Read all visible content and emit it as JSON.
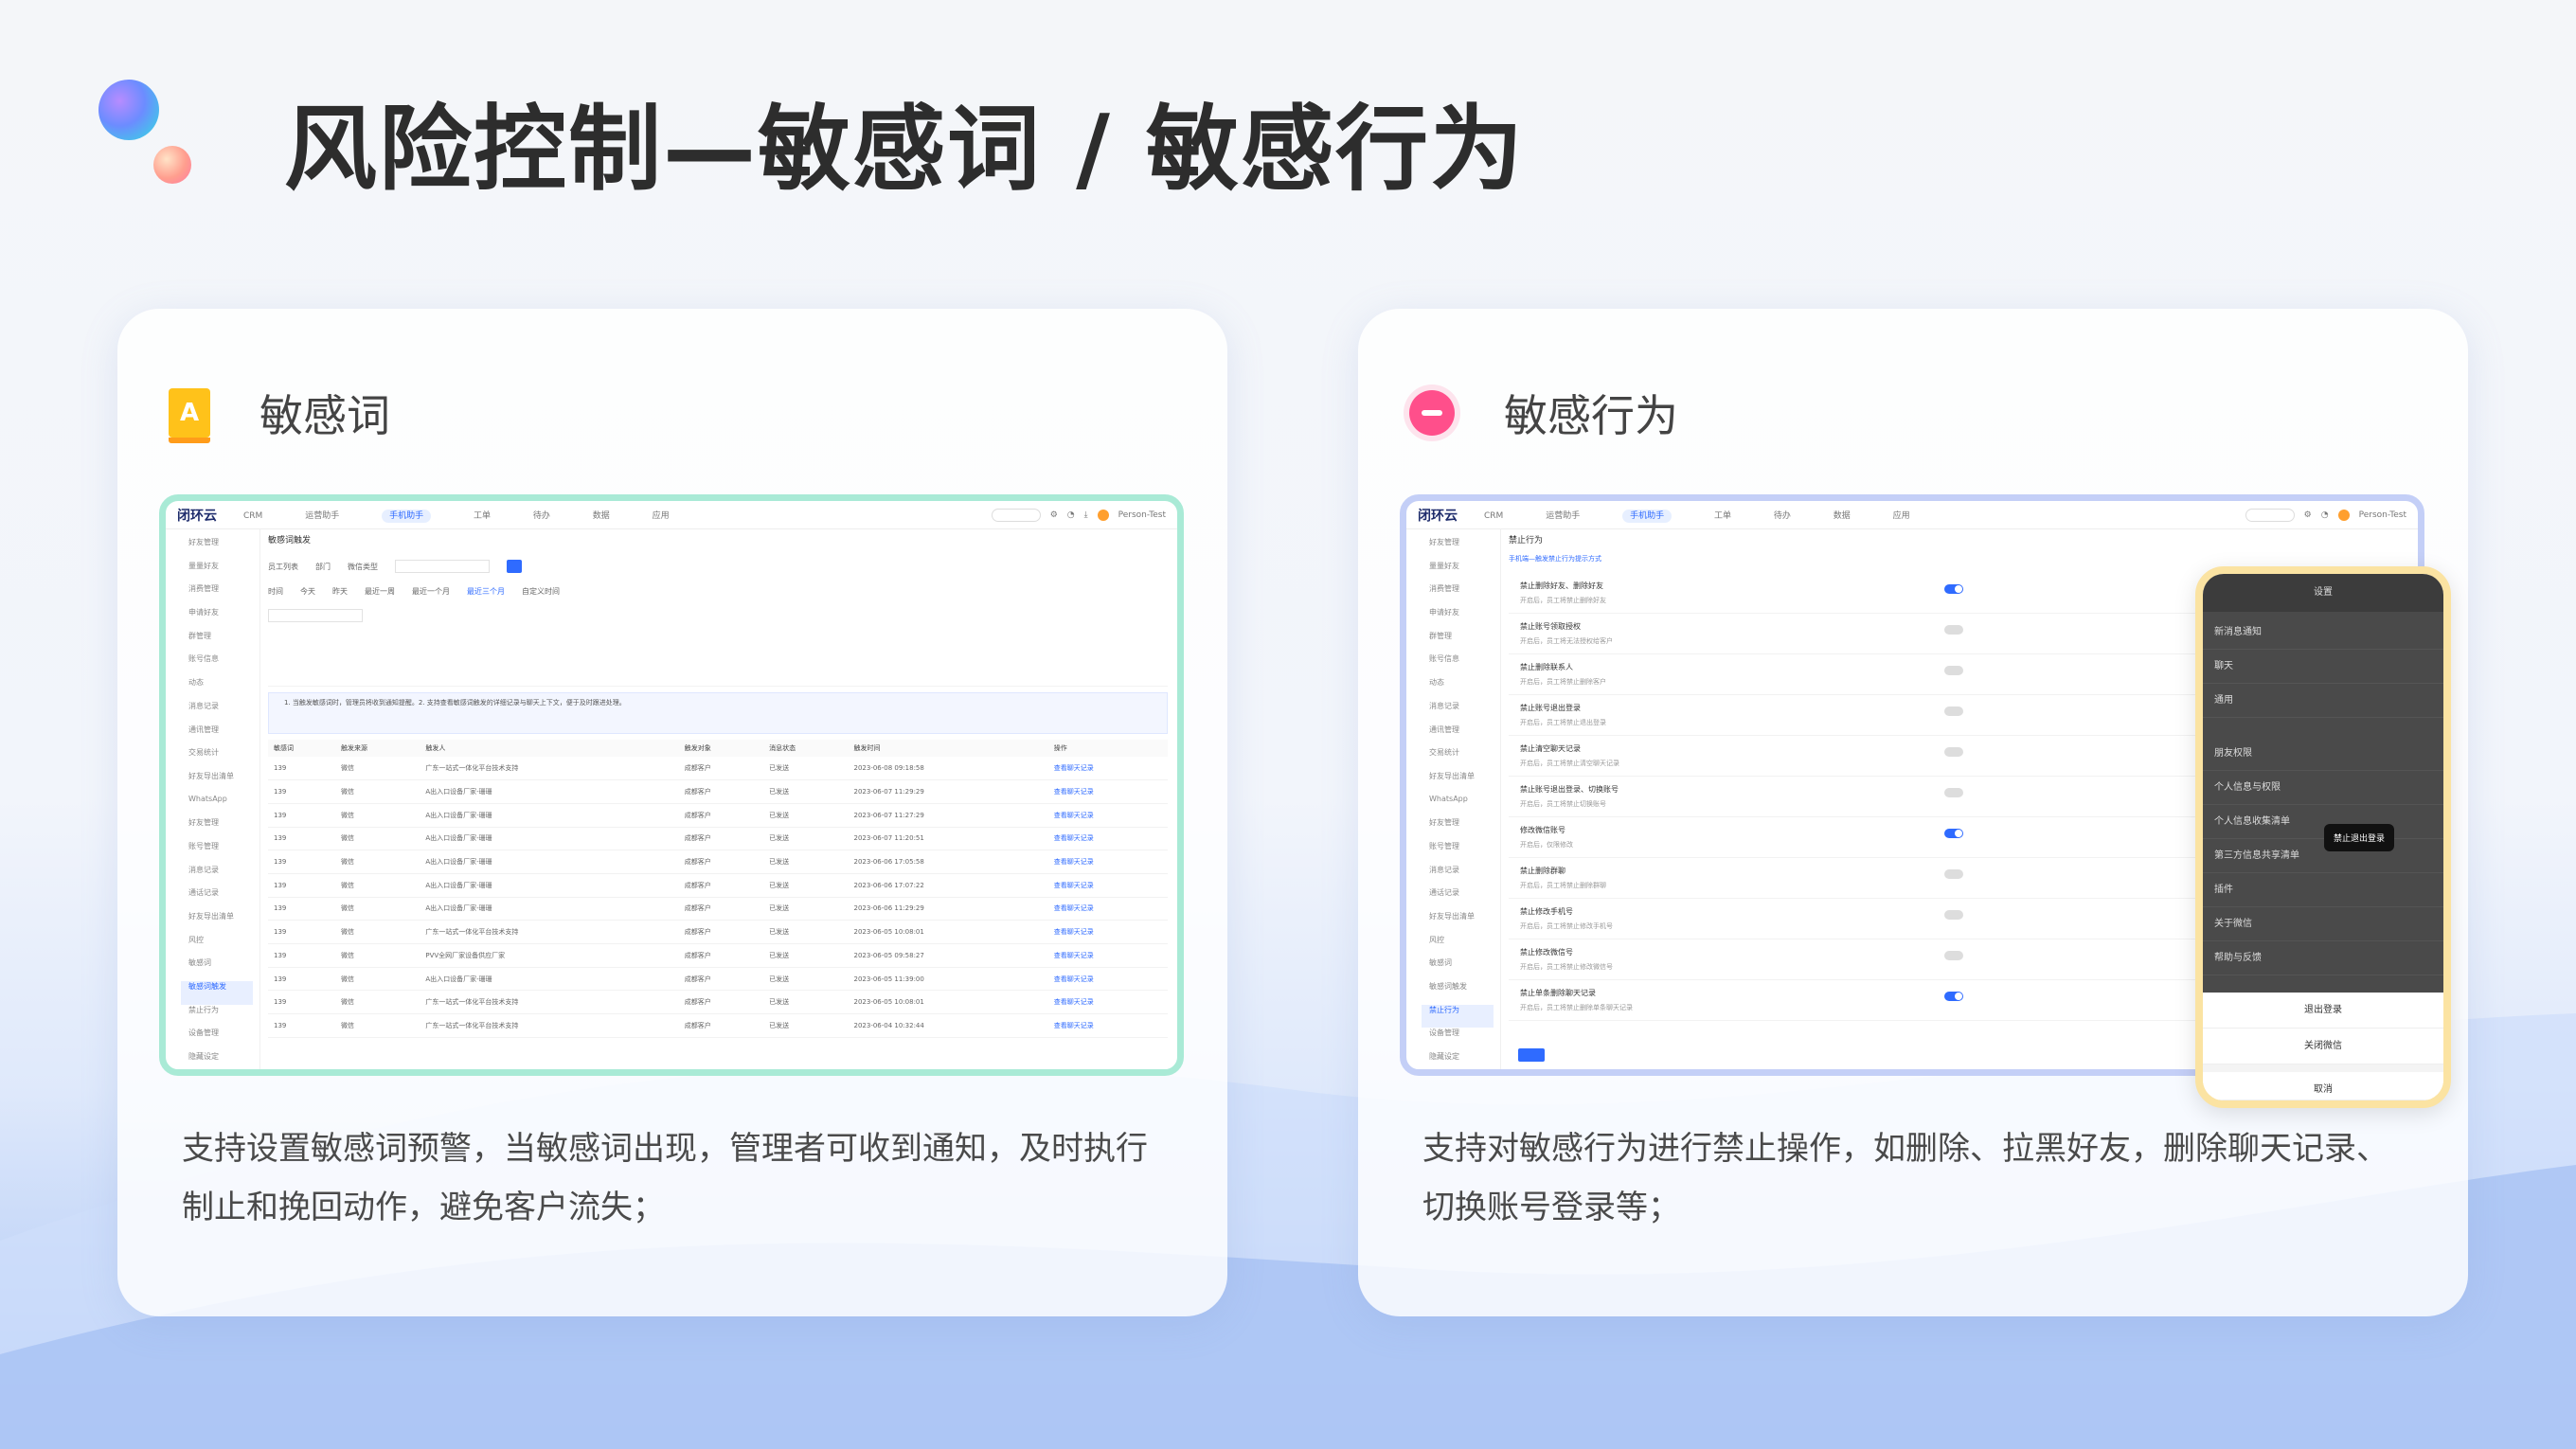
{
  "page": {
    "title": "风险控制—敏感词 / 敏感行为"
  },
  "cards": [
    {
      "heading": "敏感词",
      "icon": "sensitive-word-icon",
      "description": "支持设置敏感词预警，当敏感词出现，管理者可收到通知，及时执行制止和挽回动作，避免客户流失；"
    },
    {
      "heading": "敏感行为",
      "icon": "forbidden-icon",
      "description": "支持对敏感行为进行禁止操作，如删除、拉黑好友，删除聊天记录、切换账号登录等；"
    }
  ],
  "app": {
    "logo": "闭环云",
    "nav": [
      "CRM",
      "运营助手",
      "手机助手",
      "工单",
      "待办",
      "数据",
      "应用"
    ],
    "active_nav": "手机助手",
    "user": "Person-Test"
  },
  "word_screen": {
    "breadcrumb": "敏感词触发",
    "sidebar": [
      "好友管理",
      "量量好友",
      "消费管理",
      "申请好友",
      "群管理",
      "账号信息",
      "动态",
      "消息记录",
      "通讯管理",
      "交易统计",
      "好友导出清单",
      "WhatsApp",
      "好友管理",
      "账号管理",
      "消息记录",
      "通话记录",
      "好友导出清单",
      "风控",
      "敏感词",
      "敏感词触发",
      "禁止行为",
      "设备管理",
      "隐藏设定"
    ],
    "sidebar_active": "敏感词触发",
    "filters": [
      "员工列表",
      "部门",
      "微信类型",
      "时间"
    ],
    "time_options": [
      "今天",
      "昨天",
      "最近一周",
      "最近一个月",
      "最近三个月",
      "自定义时间"
    ],
    "notice": "1. 当触发敏感词时，管理员将收到通知提醒。2. 支持查看敏感词触发的详细记录与聊天上下文，便于及时跟进处理。",
    "table": {
      "headers": [
        "敏感词",
        "触发来源",
        "触发人",
        "触发对象",
        "消息状态",
        "触发时间",
        "操作"
      ],
      "rows": [
        [
          "139",
          "微信",
          "广东一站式一体化平台技术支持",
          "成都客户",
          "已发送",
          "2023-06-08 09:18:58",
          "查看聊天记录"
        ],
        [
          "139",
          "微信",
          "A出入口设备厂家-珊珊",
          "成都客户",
          "已发送",
          "2023-06-07 11:29:29",
          "查看聊天记录"
        ],
        [
          "139",
          "微信",
          "A出入口设备厂家-珊珊",
          "成都客户",
          "已发送",
          "2023-06-07 11:27:29",
          "查看聊天记录"
        ],
        [
          "139",
          "微信",
          "A出入口设备厂家-珊珊",
          "成都客户",
          "已发送",
          "2023-06-07 11:20:51",
          "查看聊天记录"
        ],
        [
          "139",
          "微信",
          "A出入口设备厂家-珊珊",
          "成都客户",
          "已发送",
          "2023-06-06 17:05:58",
          "查看聊天记录"
        ],
        [
          "139",
          "微信",
          "A出入口设备厂家-珊珊",
          "成都客户",
          "已发送",
          "2023-06-06 17:07:22",
          "查看聊天记录"
        ],
        [
          "139",
          "微信",
          "A出入口设备厂家-珊珊",
          "成都客户",
          "已发送",
          "2023-06-06 11:29:29",
          "查看聊天记录"
        ],
        [
          "139",
          "微信",
          "广东一站式一体化平台技术支持",
          "成都客户",
          "已发送",
          "2023-06-05 10:08:01",
          "查看聊天记录"
        ],
        [
          "139",
          "微信",
          "PVV全网厂家设备供应厂家",
          "成都客户",
          "已发送",
          "2023-06-05 09:58:27",
          "查看聊天记录"
        ],
        [
          "139",
          "微信",
          "A出入口设备厂家-珊珊",
          "成都客户",
          "已发送",
          "2023-06-05 11:39:00",
          "查看聊天记录"
        ],
        [
          "139",
          "微信",
          "广东一站式一体化平台技术支持",
          "成都客户",
          "已发送",
          "2023-06-05 10:08:01",
          "查看聊天记录"
        ],
        [
          "139",
          "微信",
          "广东一站式一体化平台技术支持",
          "成都客户",
          "已发送",
          "2023-06-04 10:32:44",
          "查看聊天记录"
        ]
      ]
    }
  },
  "behavior_screen": {
    "breadcrumb": "禁止行为",
    "option": "手机端—触发禁止行为提示方式",
    "rules": [
      {
        "title": "禁止删除好友、删除好友",
        "sub": "开启后，员工将禁止删除好友",
        "on": true
      },
      {
        "title": "禁止账号领取授权",
        "sub": "开启后，员工将无法授权给客户",
        "on": false
      },
      {
        "title": "禁止删除联系人",
        "sub": "开启后，员工将禁止删除客户",
        "on": false
      },
      {
        "title": "禁止账号退出登录",
        "sub": "开启后，员工将禁止退出登录",
        "on": false
      },
      {
        "title": "禁止清空聊天记录",
        "sub": "开启后，员工将禁止清空聊天记录",
        "on": false
      },
      {
        "title": "禁止账号退出登录、切换账号",
        "sub": "开启后，员工将禁止切换账号",
        "on": false
      },
      {
        "title": "修改微信账号",
        "sub": "开启后，仅限修改",
        "on": true
      },
      {
        "title": "禁止删除群聊",
        "sub": "开启后，员工将禁止删除群聊",
        "on": false
      },
      {
        "title": "禁止修改手机号",
        "sub": "开启后，员工将禁止修改手机号",
        "on": false
      },
      {
        "title": "禁止修改微信号",
        "sub": "开启后，员工将禁止修改微信号",
        "on": false
      },
      {
        "title": "禁止单条删除聊天记录",
        "sub": "开启后，员工将禁止删除单条聊天记录",
        "on": true
      }
    ],
    "phone": {
      "title": "设置",
      "items": [
        "新消息通知",
        "聊天",
        "通用",
        "",
        "朋友权限",
        "个人信息与权限",
        "个人信息收集清单",
        "第三方信息共享清单",
        "插件",
        "关于微信",
        "帮助与反馈"
      ],
      "toast": "禁止退出登录",
      "sheet": [
        "退出登录",
        "关闭微信"
      ],
      "cancel": "取消"
    }
  }
}
